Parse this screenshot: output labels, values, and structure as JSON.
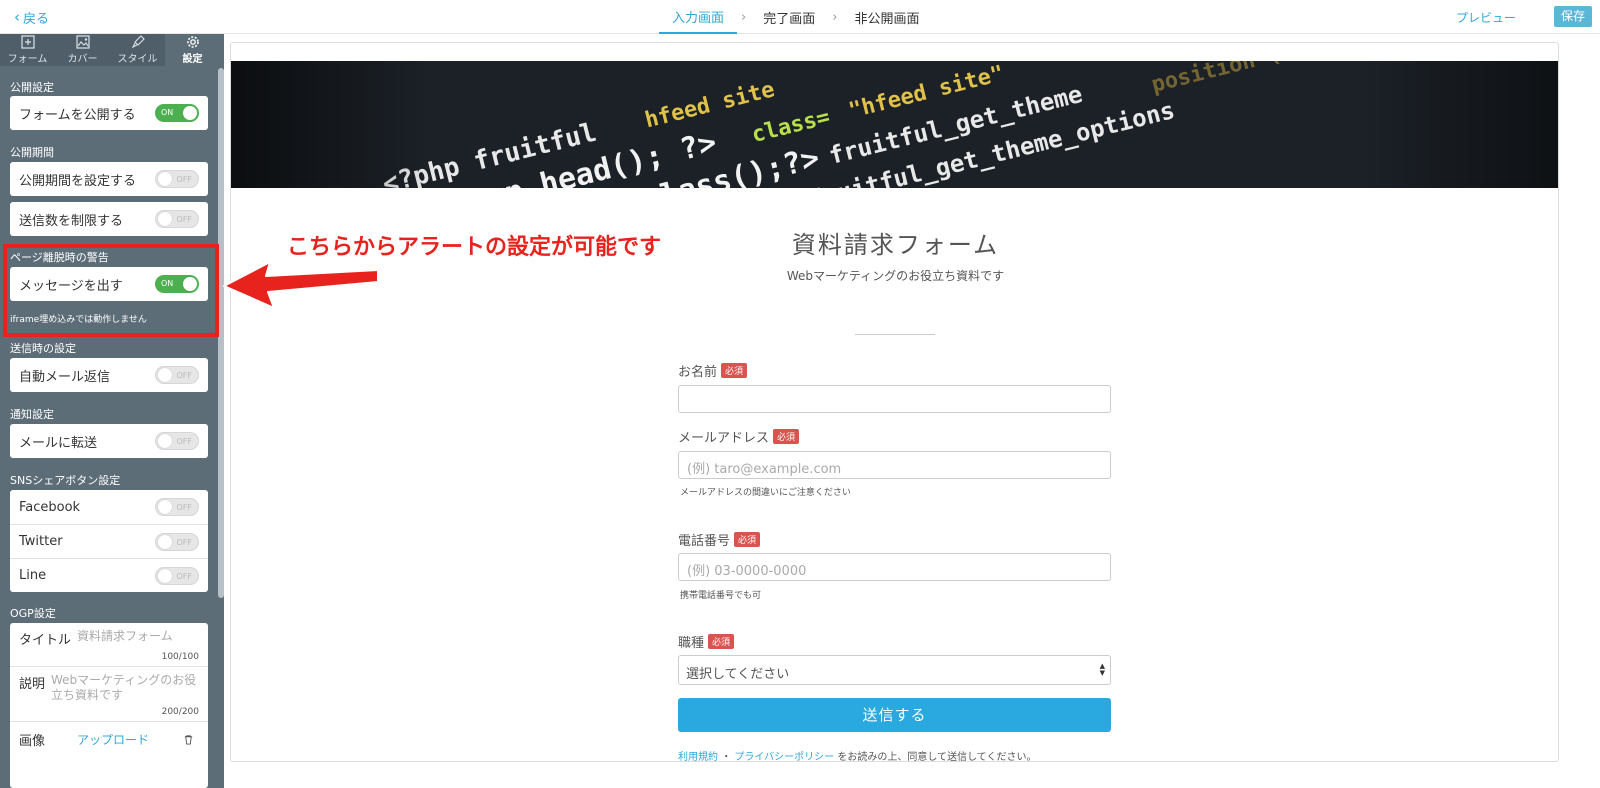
{
  "topbar": {
    "back_label": "戻る",
    "steps": [
      "入力画面",
      "完了画面",
      "非公開画面"
    ],
    "preview_label": "プレビュー",
    "save_label": "保存"
  },
  "sidebar": {
    "tabs": [
      "フォーム",
      "カバー",
      "スタイル",
      "設定"
    ],
    "active_tab": "設定",
    "sections": {
      "publish": {
        "label": "公開設定",
        "rows": [
          {
            "label": "フォームを公開する",
            "state": "ON"
          }
        ]
      },
      "period": {
        "label": "公開期間",
        "rows": [
          {
            "label": "公開期間を設定する",
            "state": "OFF"
          },
          {
            "label": "送信数を制限する",
            "state": "OFF"
          }
        ]
      },
      "leave_warning": {
        "label": "ページ離脱時の警告",
        "rows": [
          {
            "label": "メッセージを出す",
            "state": "ON"
          }
        ],
        "note": "iframe埋め込みでは動作しません"
      },
      "on_submit": {
        "label": "送信時の設定",
        "rows": [
          {
            "label": "自動メール返信",
            "state": "OFF"
          }
        ]
      },
      "notify": {
        "label": "通知設定",
        "rows": [
          {
            "label": "メールに転送",
            "state": "OFF"
          }
        ]
      },
      "sns": {
        "label": "SNSシェアボタン設定",
        "rows": [
          {
            "label": "Facebook",
            "state": "OFF"
          },
          {
            "label": "Twitter",
            "state": "OFF"
          },
          {
            "label": "Line",
            "state": "OFF"
          }
        ]
      },
      "ogp": {
        "label": "OGP設定",
        "title_key": "タイトル",
        "title_value": "資料請求フォーム",
        "title_count": "100/100",
        "desc_key": "説明",
        "desc_value": "Webマーケティングのお役立ち資料です",
        "desc_count": "200/200",
        "image_key": "画像",
        "upload_label": "アップロード"
      }
    }
  },
  "annotation": {
    "text": "こちらからアラートの設定が可能です",
    "color": "#e8231e"
  },
  "form": {
    "title": "資料請求フォーム",
    "description": "Webマーケティングのお役立ち資料です",
    "required_badge": "必須",
    "fields": {
      "name": {
        "label": "お名前",
        "placeholder": ""
      },
      "email": {
        "label": "メールアドレス",
        "placeholder": "(例) taro@example.com",
        "help": "メールアドレスの間違いにご注意ください"
      },
      "phone": {
        "label": "電話番号",
        "placeholder": "(例) 03-0000-0000",
        "help": "携帯電話番号でも可"
      },
      "job": {
        "label": "職種",
        "selected": "選択してください"
      }
    },
    "submit_label": "送信する",
    "terms": {
      "link1": "利用規約",
      "sep": "・",
      "link2": "プライバシーポリシー",
      "rest": "をお読みの上、同意して送信してください。"
    }
  },
  "colors": {
    "accent": "#2fa7d8",
    "sidebar_bg": "#5d6d78",
    "toggle_on": "#4caf50",
    "submit": "#2aa8e0",
    "required": "#d9534f"
  }
}
